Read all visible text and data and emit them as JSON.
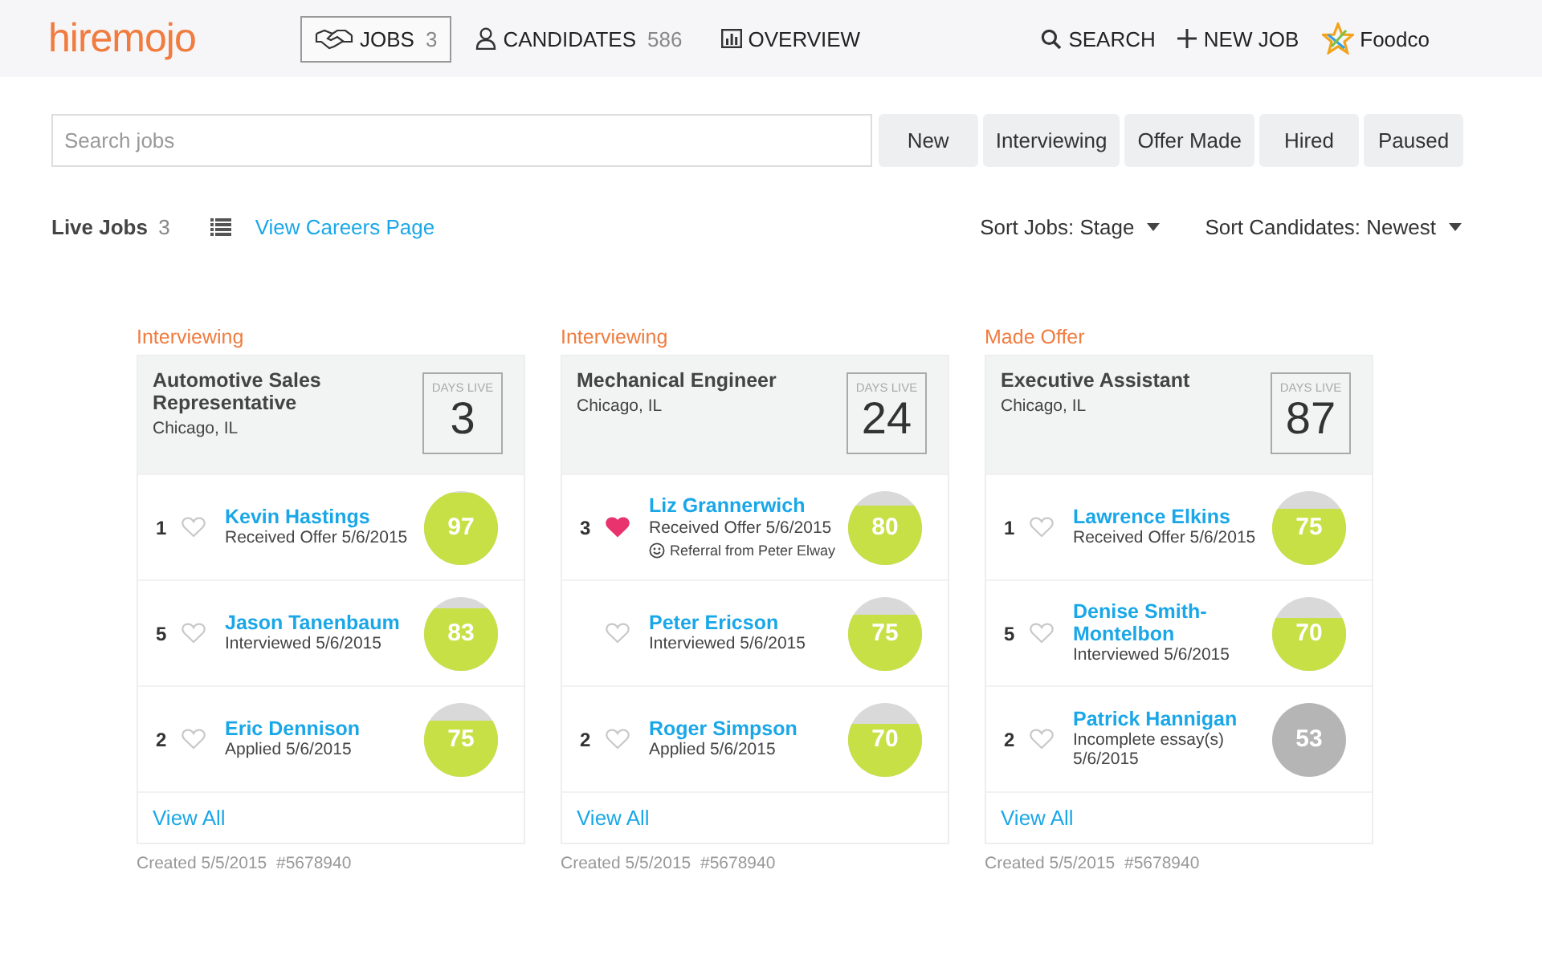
{
  "header": {
    "logo": "hiremojo",
    "nav": [
      {
        "label": "JOBS",
        "count": "3",
        "selected": true
      },
      {
        "label": "CANDIDATES",
        "count": "586",
        "selected": false
      },
      {
        "label": "OVERVIEW",
        "selected": false
      }
    ],
    "actions": [
      "SEARCH",
      "NEW JOB"
    ],
    "company": "Foodco"
  },
  "search": {
    "placeholder": "Search jobs"
  },
  "filters": [
    {
      "label": "New",
      "selected": false
    },
    {
      "label": "Interviewing",
      "selected": false
    },
    {
      "label": "Offer Made",
      "selected": false
    },
    {
      "label": "Hired",
      "selected": false
    },
    {
      "label": "Paused",
      "selected": false
    }
  ],
  "toolbar": {
    "title": "Live Jobs",
    "count": "3",
    "link": "View Careers Page",
    "sorts": [
      "Sort Jobs: Stage",
      "Sort Candidates: Newest"
    ]
  },
  "jobs": [
    {
      "stage": "Interviewing",
      "title": "Automotive Sales Representative",
      "location": "Chicago, IL",
      "days_label": "DAYS LIVE",
      "days": "3",
      "view_all": "View All",
      "footer": "Created 5/5/2015  #5678940",
      "candidates": [
        {
          "rank": "1",
          "favorite": false,
          "name": "Kevin Hastings",
          "status": "Received Offer 5/6/2015",
          "score": "97",
          "incomplete": false
        },
        {
          "rank": "5",
          "favorite": false,
          "name": "Jason Tanenbaum",
          "status": "Interviewed 5/6/2015",
          "score": "83",
          "incomplete": false
        },
        {
          "rank": "2",
          "favorite": false,
          "name": "Eric Dennison",
          "status": "Applied 5/6/2015",
          "score": "75",
          "incomplete": false
        }
      ]
    },
    {
      "stage": "Interviewing",
      "title": "Mechanical Engineer",
      "location": "Chicago, IL",
      "days_label": "DAYS LIVE",
      "days": "24",
      "view_all": "View All",
      "footer": "Created 5/5/2015  #5678940",
      "candidates": [
        {
          "rank": "3",
          "favorite": true,
          "name": "Liz Grannerwich",
          "status": "Received Offer 5/6/2015",
          "referral": "Referral from Peter Elway",
          "score": "80",
          "incomplete": false
        },
        {
          "favorite": false,
          "name": "Peter Ericson",
          "status": "Interviewed 5/6/2015",
          "score": "75",
          "incomplete": false
        },
        {
          "rank": "2",
          "favorite": false,
          "name": "Roger Simpson",
          "status": "Applied 5/6/2015",
          "score": "70",
          "incomplete": false
        }
      ]
    },
    {
      "stage": "Made Offer",
      "title": "Executive Assistant",
      "location": "Chicago, IL",
      "days_label": "DAYS LIVE",
      "days": "87",
      "view_all": "View All",
      "footer": "Created 5/5/2015  #5678940",
      "candidates": [
        {
          "rank": "1",
          "favorite": false,
          "name": "Lawrence Elkins",
          "status": "Received Offer 5/6/2015",
          "score": "75",
          "incomplete": false
        },
        {
          "rank": "5",
          "favorite": false,
          "name": "Denise Smith-Montelbon",
          "status": "Interviewed 5/6/2015",
          "score": "70",
          "incomplete": false
        },
        {
          "rank": "2",
          "favorite": false,
          "name": "Patrick Hannigan",
          "status": "Incomplete essay(s) 5/6/2015",
          "score": "53",
          "incomplete": true
        }
      ]
    }
  ]
}
